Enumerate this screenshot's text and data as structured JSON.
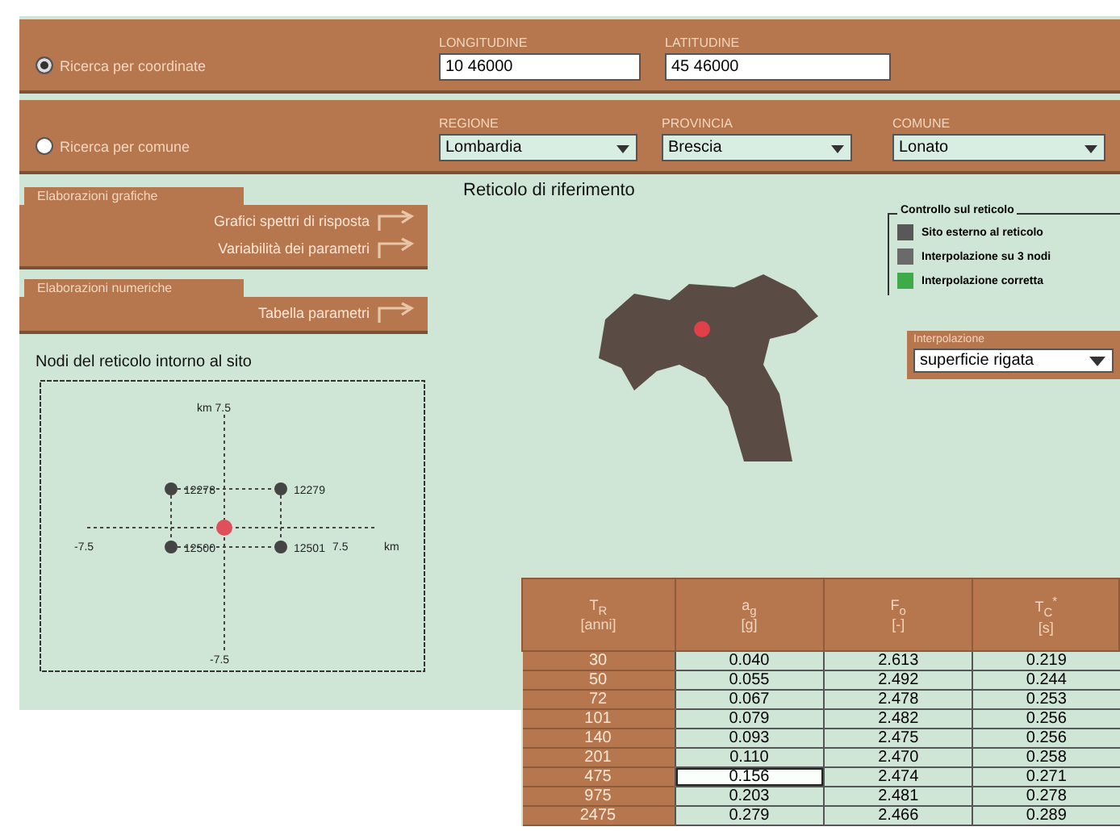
{
  "search_by_coordinates": {
    "label": "Ricerca per coordinate",
    "selected": true,
    "fields": [
      {
        "label": "LONGITUDINE",
        "value": "10 46000"
      },
      {
        "label": "LATITUDINE",
        "value": "45 46000"
      }
    ]
  },
  "search_by_municipality": {
    "label": "Ricerca per comune",
    "selected": false,
    "selects": [
      {
        "label": "REGIONE",
        "value": "Lombardia"
      },
      {
        "label": "PROVINCIA",
        "value": "Brescia"
      },
      {
        "label": "COMUNE",
        "value": "Lonato"
      }
    ]
  },
  "graphic_panel": {
    "title": "Elaborazioni grafiche",
    "links": [
      "Grafici spettri di risposta",
      "Variabilità dei parametri"
    ]
  },
  "numeric_panel": {
    "title": "Elaborazioni numeriche",
    "links": [
      "Tabella parametri"
    ]
  },
  "nodes": {
    "title": "Nodi del reticolo intorno al sito",
    "top_label": "km 7.5",
    "bottom_label": "-7.5",
    "left_label": "-7.5",
    "right_label": "7.5",
    "unit": "km",
    "node_ids": [
      "12278",
      "12279",
      "12500",
      "12501"
    ]
  },
  "reference_grid": {
    "title": "Reticolo di riferimento"
  },
  "legend": {
    "title": "Controllo sul reticolo",
    "items": [
      {
        "label": "Sito esterno al reticolo",
        "color": "#585858"
      },
      {
        "label": "Interpolazione su 3 nodi",
        "color": "#6a6a6a"
      },
      {
        "label": "Interpolazione corretta",
        "color": "#3faa48"
      }
    ]
  },
  "interpolation": {
    "label": "Interpolazione",
    "value": "superficie rigata"
  },
  "table": {
    "columns": [
      {
        "name": "T$_{R}$",
        "unit": "[anni]"
      },
      {
        "name": "a$_{g}$",
        "unit": "[g]"
      },
      {
        "name": "F$_{o}$",
        "unit": "[-]"
      },
      {
        "name": "T$_{C}$$^{*}$",
        "unit": "[s]"
      }
    ],
    "rows": [
      {
        "tr": "30",
        "ag": "0.040",
        "fo": "2.613",
        "tc": "0.219",
        "selected": false
      },
      {
        "tr": "50",
        "ag": "0.055",
        "fo": "2.492",
        "tc": "0.244",
        "selected": false
      },
      {
        "tr": "72",
        "ag": "0.067",
        "fo": "2.478",
        "tc": "0.253",
        "selected": false
      },
      {
        "tr": "101",
        "ag": "0.079",
        "fo": "2.482",
        "tc": "0.256",
        "selected": false
      },
      {
        "tr": "140",
        "ag": "0.093",
        "fo": "2.475",
        "tc": "0.256",
        "selected": false
      },
      {
        "tr": "201",
        "ag": "0.110",
        "fo": "2.470",
        "tc": "0.258",
        "selected": false
      },
      {
        "tr": "475",
        "ag": "0.156",
        "fo": "2.474",
        "tc": "0.271",
        "selected": true
      },
      {
        "tr": "975",
        "ag": "0.203",
        "fo": "2.481",
        "tc": "0.278",
        "selected": false
      },
      {
        "tr": "2475",
        "ag": "0.279",
        "fo": "2.466",
        "tc": "0.289",
        "selected": false
      }
    ]
  }
}
